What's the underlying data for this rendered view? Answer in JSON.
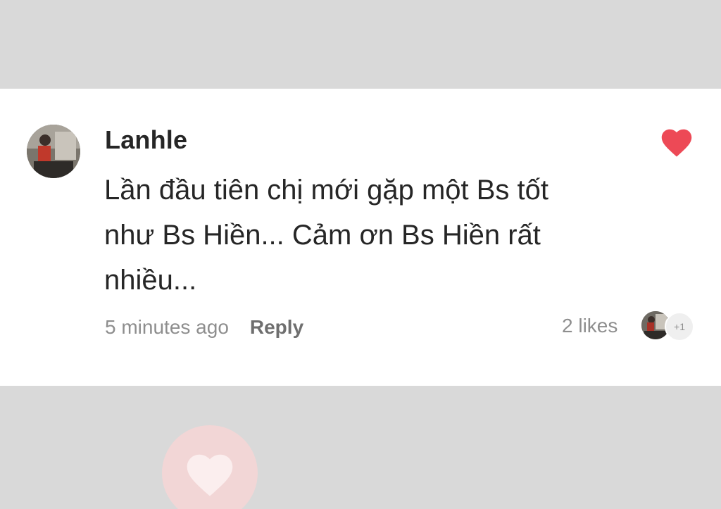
{
  "comment": {
    "author": "Lanhle",
    "text_line_1": "Lần đầu tiên chị mới gặp một Bs tốt",
    "text_line_2": "như Bs Hiền... Cảm ơn Bs Hiền rất",
    "text_line_3": "nhiều...",
    "timestamp": "5 minutes ago",
    "reply_label": "Reply",
    "likes_label": "2 likes",
    "more_likers_label": "+1",
    "liked": true
  },
  "colors": {
    "heart": "#ed4956",
    "background": "#d9d9d9",
    "card": "#ffffff",
    "text_primary": "#262626",
    "text_secondary": "#8e8e8e"
  },
  "icons": {
    "like": "heart-icon",
    "background_overlay": "heart-icon"
  }
}
